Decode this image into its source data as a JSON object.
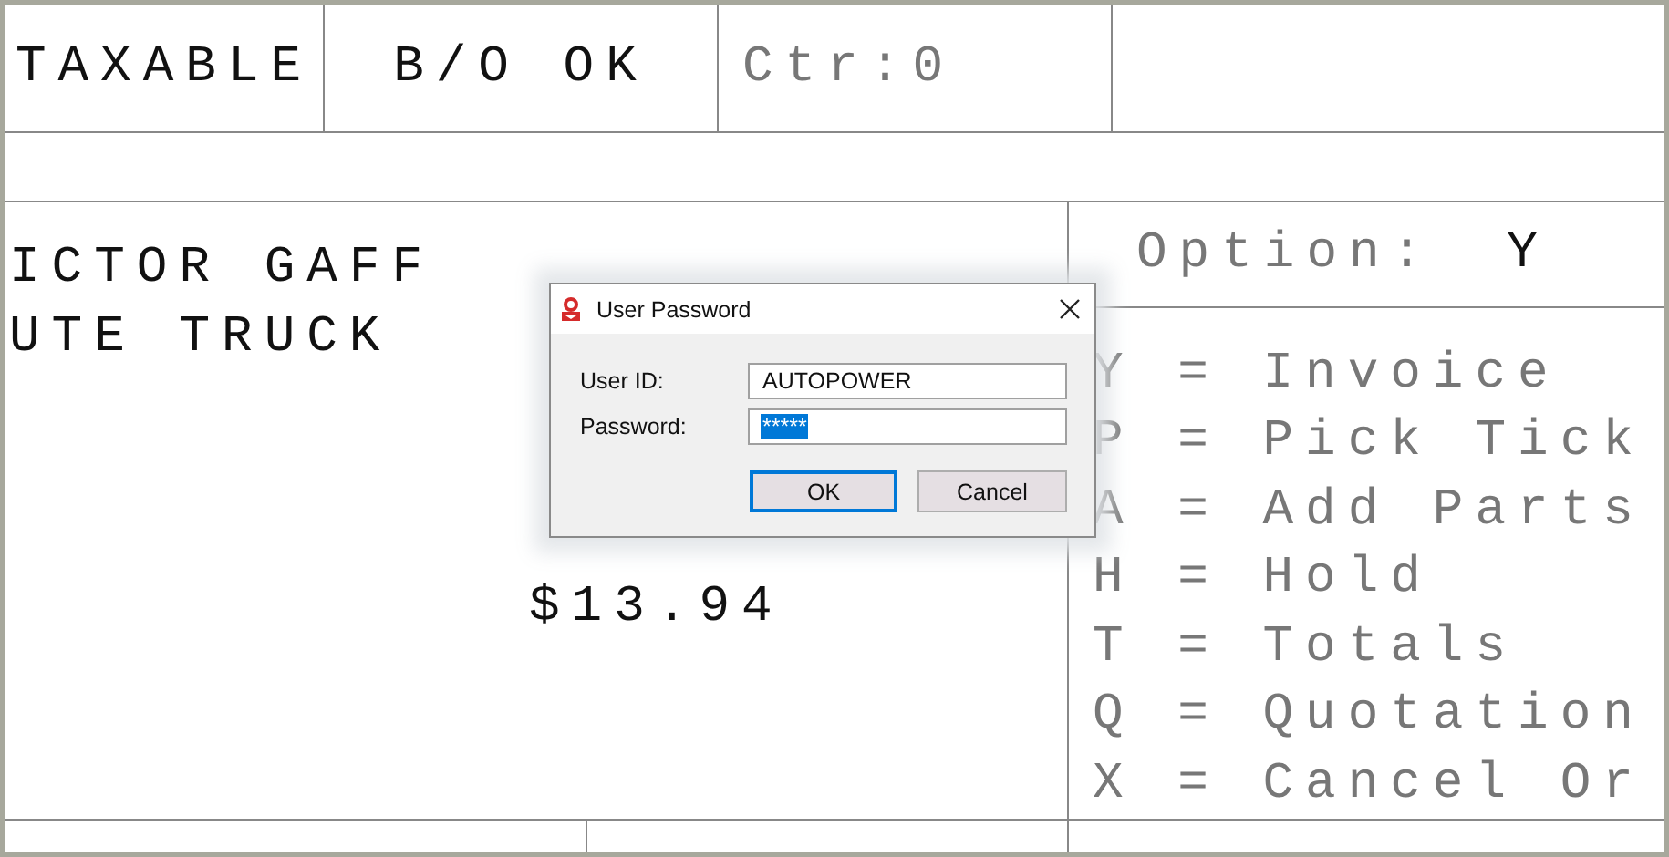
{
  "status_cells": [
    {
      "text": "TAXABLE",
      "kind": "label"
    },
    {
      "text": "B/O OK",
      "kind": "label"
    },
    {
      "text": "Ctr:0",
      "kind": "counter"
    }
  ],
  "customer": {
    "lines": [
      "ICTOR GAFF",
      "UTE TRUCK"
    ],
    "amount": "$13.94"
  },
  "option": {
    "label": "Option:",
    "value": "Y"
  },
  "menu": [
    "Y = Invoice",
    "P = Pick Tick",
    "A = Add Parts",
    "H = Hold",
    "T = Totals",
    "Q = Quotation",
    "X = Cancel Or"
  ],
  "dialog": {
    "title": "User Password",
    "fields": [
      {
        "label": "User ID:",
        "value": "AUTOPOWER",
        "selected": false
      },
      {
        "label": "Password:",
        "value": "*****",
        "selected": true
      }
    ],
    "buttons": [
      {
        "label": "OK",
        "default": true
      },
      {
        "label": "Cancel",
        "default": false
      }
    ]
  }
}
